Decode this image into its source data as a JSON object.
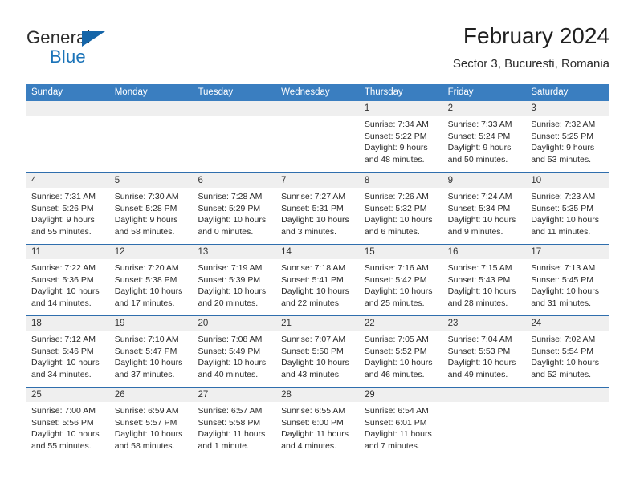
{
  "brand": {
    "name_part1": "General",
    "name_part2": "Blue",
    "accent_color": "#1a73b8",
    "triangle_color": "#1565a8"
  },
  "header": {
    "title": "February 2024",
    "subtitle": "Sector 3, Bucuresti, Romania"
  },
  "calendar": {
    "header_bg": "#3a7ec0",
    "row_divider": "#2f6ead",
    "daynum_bg": "#efefef",
    "weekdays": [
      "Sunday",
      "Monday",
      "Tuesday",
      "Wednesday",
      "Thursday",
      "Friday",
      "Saturday"
    ],
    "weeks": [
      [
        {
          "day": "",
          "lines": []
        },
        {
          "day": "",
          "lines": []
        },
        {
          "day": "",
          "lines": []
        },
        {
          "day": "",
          "lines": []
        },
        {
          "day": "1",
          "lines": [
            "Sunrise: 7:34 AM",
            "Sunset: 5:22 PM",
            "Daylight: 9 hours",
            "and 48 minutes."
          ]
        },
        {
          "day": "2",
          "lines": [
            "Sunrise: 7:33 AM",
            "Sunset: 5:24 PM",
            "Daylight: 9 hours",
            "and 50 minutes."
          ]
        },
        {
          "day": "3",
          "lines": [
            "Sunrise: 7:32 AM",
            "Sunset: 5:25 PM",
            "Daylight: 9 hours",
            "and 53 minutes."
          ]
        }
      ],
      [
        {
          "day": "4",
          "lines": [
            "Sunrise: 7:31 AM",
            "Sunset: 5:26 PM",
            "Daylight: 9 hours",
            "and 55 minutes."
          ]
        },
        {
          "day": "5",
          "lines": [
            "Sunrise: 7:30 AM",
            "Sunset: 5:28 PM",
            "Daylight: 9 hours",
            "and 58 minutes."
          ]
        },
        {
          "day": "6",
          "lines": [
            "Sunrise: 7:28 AM",
            "Sunset: 5:29 PM",
            "Daylight: 10 hours",
            "and 0 minutes."
          ]
        },
        {
          "day": "7",
          "lines": [
            "Sunrise: 7:27 AM",
            "Sunset: 5:31 PM",
            "Daylight: 10 hours",
            "and 3 minutes."
          ]
        },
        {
          "day": "8",
          "lines": [
            "Sunrise: 7:26 AM",
            "Sunset: 5:32 PM",
            "Daylight: 10 hours",
            "and 6 minutes."
          ]
        },
        {
          "day": "9",
          "lines": [
            "Sunrise: 7:24 AM",
            "Sunset: 5:34 PM",
            "Daylight: 10 hours",
            "and 9 minutes."
          ]
        },
        {
          "day": "10",
          "lines": [
            "Sunrise: 7:23 AM",
            "Sunset: 5:35 PM",
            "Daylight: 10 hours",
            "and 11 minutes."
          ]
        }
      ],
      [
        {
          "day": "11",
          "lines": [
            "Sunrise: 7:22 AM",
            "Sunset: 5:36 PM",
            "Daylight: 10 hours",
            "and 14 minutes."
          ]
        },
        {
          "day": "12",
          "lines": [
            "Sunrise: 7:20 AM",
            "Sunset: 5:38 PM",
            "Daylight: 10 hours",
            "and 17 minutes."
          ]
        },
        {
          "day": "13",
          "lines": [
            "Sunrise: 7:19 AM",
            "Sunset: 5:39 PM",
            "Daylight: 10 hours",
            "and 20 minutes."
          ]
        },
        {
          "day": "14",
          "lines": [
            "Sunrise: 7:18 AM",
            "Sunset: 5:41 PM",
            "Daylight: 10 hours",
            "and 22 minutes."
          ]
        },
        {
          "day": "15",
          "lines": [
            "Sunrise: 7:16 AM",
            "Sunset: 5:42 PM",
            "Daylight: 10 hours",
            "and 25 minutes."
          ]
        },
        {
          "day": "16",
          "lines": [
            "Sunrise: 7:15 AM",
            "Sunset: 5:43 PM",
            "Daylight: 10 hours",
            "and 28 minutes."
          ]
        },
        {
          "day": "17",
          "lines": [
            "Sunrise: 7:13 AM",
            "Sunset: 5:45 PM",
            "Daylight: 10 hours",
            "and 31 minutes."
          ]
        }
      ],
      [
        {
          "day": "18",
          "lines": [
            "Sunrise: 7:12 AM",
            "Sunset: 5:46 PM",
            "Daylight: 10 hours",
            "and 34 minutes."
          ]
        },
        {
          "day": "19",
          "lines": [
            "Sunrise: 7:10 AM",
            "Sunset: 5:47 PM",
            "Daylight: 10 hours",
            "and 37 minutes."
          ]
        },
        {
          "day": "20",
          "lines": [
            "Sunrise: 7:08 AM",
            "Sunset: 5:49 PM",
            "Daylight: 10 hours",
            "and 40 minutes."
          ]
        },
        {
          "day": "21",
          "lines": [
            "Sunrise: 7:07 AM",
            "Sunset: 5:50 PM",
            "Daylight: 10 hours",
            "and 43 minutes."
          ]
        },
        {
          "day": "22",
          "lines": [
            "Sunrise: 7:05 AM",
            "Sunset: 5:52 PM",
            "Daylight: 10 hours",
            "and 46 minutes."
          ]
        },
        {
          "day": "23",
          "lines": [
            "Sunrise: 7:04 AM",
            "Sunset: 5:53 PM",
            "Daylight: 10 hours",
            "and 49 minutes."
          ]
        },
        {
          "day": "24",
          "lines": [
            "Sunrise: 7:02 AM",
            "Sunset: 5:54 PM",
            "Daylight: 10 hours",
            "and 52 minutes."
          ]
        }
      ],
      [
        {
          "day": "25",
          "lines": [
            "Sunrise: 7:00 AM",
            "Sunset: 5:56 PM",
            "Daylight: 10 hours",
            "and 55 minutes."
          ]
        },
        {
          "day": "26",
          "lines": [
            "Sunrise: 6:59 AM",
            "Sunset: 5:57 PM",
            "Daylight: 10 hours",
            "and 58 minutes."
          ]
        },
        {
          "day": "27",
          "lines": [
            "Sunrise: 6:57 AM",
            "Sunset: 5:58 PM",
            "Daylight: 11 hours",
            "and 1 minute."
          ]
        },
        {
          "day": "28",
          "lines": [
            "Sunrise: 6:55 AM",
            "Sunset: 6:00 PM",
            "Daylight: 11 hours",
            "and 4 minutes."
          ]
        },
        {
          "day": "29",
          "lines": [
            "Sunrise: 6:54 AM",
            "Sunset: 6:01 PM",
            "Daylight: 11 hours",
            "and 7 minutes."
          ]
        },
        {
          "day": "",
          "lines": []
        },
        {
          "day": "",
          "lines": []
        }
      ]
    ]
  }
}
